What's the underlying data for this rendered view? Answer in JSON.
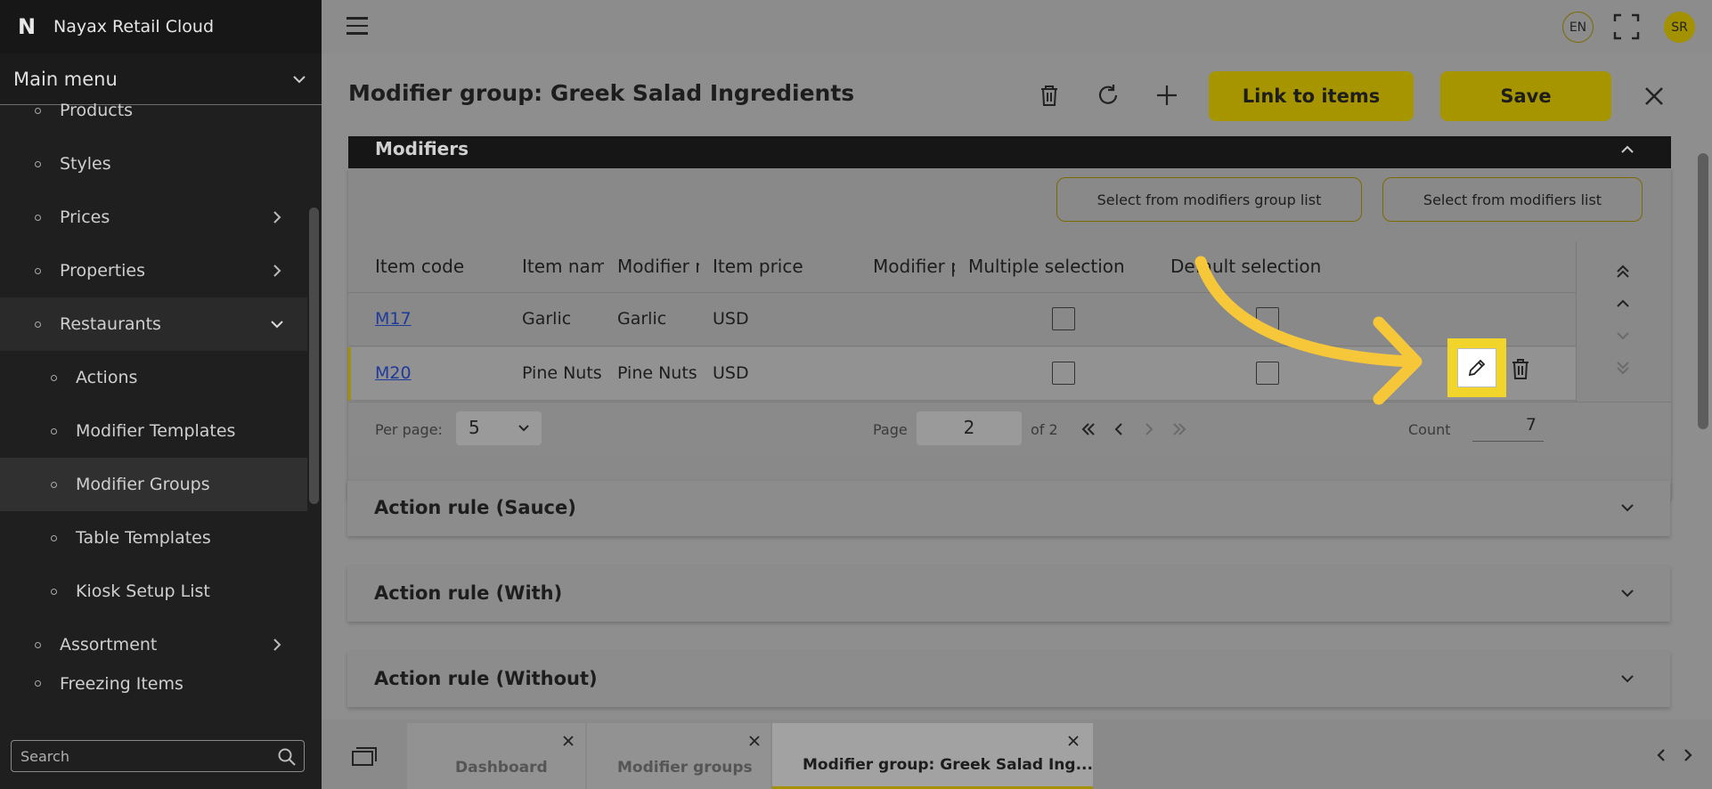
{
  "app": {
    "title": "Nayax Retail Cloud",
    "logo": "N"
  },
  "sidebar": {
    "main_menu_label": "Main menu",
    "items": [
      {
        "label": "Products",
        "level": 1
      },
      {
        "label": "Styles",
        "level": 1
      },
      {
        "label": "Prices",
        "level": 1,
        "chevron": "right"
      },
      {
        "label": "Properties",
        "level": 1,
        "chevron": "right"
      },
      {
        "label": "Restaurants",
        "level": 1,
        "chevron": "down",
        "open": true
      },
      {
        "label": "Actions",
        "level": 2
      },
      {
        "label": "Modifier Templates",
        "level": 2
      },
      {
        "label": "Modifier Groups",
        "level": 2,
        "selected": true
      },
      {
        "label": "Table Templates",
        "level": 2
      },
      {
        "label": "Kiosk Setup List",
        "level": 2
      },
      {
        "label": "Assortment",
        "level": 1,
        "chevron": "right"
      },
      {
        "label": "Freezing Items",
        "level": 1
      }
    ],
    "search_placeholder": "Search"
  },
  "topbar": {
    "language": "EN",
    "avatar_initials": "SR"
  },
  "page": {
    "title": "Modifier group: Greek Salad Ingredients",
    "link_button": "Link to items",
    "save_button": "Save"
  },
  "modifiers": {
    "section_title": "Modifiers",
    "select_group_button": "Select from modifiers group list",
    "select_list_button": "Select from modifiers list",
    "columns": [
      "Item code",
      "Item name",
      "Modifier name",
      "Item price",
      "Modifier price",
      "Multiple selection",
      "Default selection"
    ],
    "rows": [
      {
        "code": "M17",
        "item_name": "Garlic",
        "modifier_name": "Garlic",
        "price": "USD"
      },
      {
        "code": "M20",
        "item_name": "Pine Nuts",
        "modifier_name": "Pine Nuts",
        "price": "USD"
      }
    ],
    "pager": {
      "per_page_label": "Per page:",
      "per_page_value": "5",
      "page_label": "Page",
      "page_value": "2",
      "of_label": "of 2",
      "count_label": "Count",
      "count_value": "7"
    }
  },
  "accordions": [
    {
      "label": "Action rule (Sauce)"
    },
    {
      "label": "Action rule (With)"
    },
    {
      "label": "Action rule (Without)"
    }
  ],
  "tabs": [
    {
      "label": "Dashboard"
    },
    {
      "label": "Modifier groups"
    },
    {
      "label": "Modifier group: Greek Salad Ing..."
    }
  ],
  "colors": {
    "accent": "#f2d52a",
    "annotation_arrow": "#f7c73a"
  }
}
